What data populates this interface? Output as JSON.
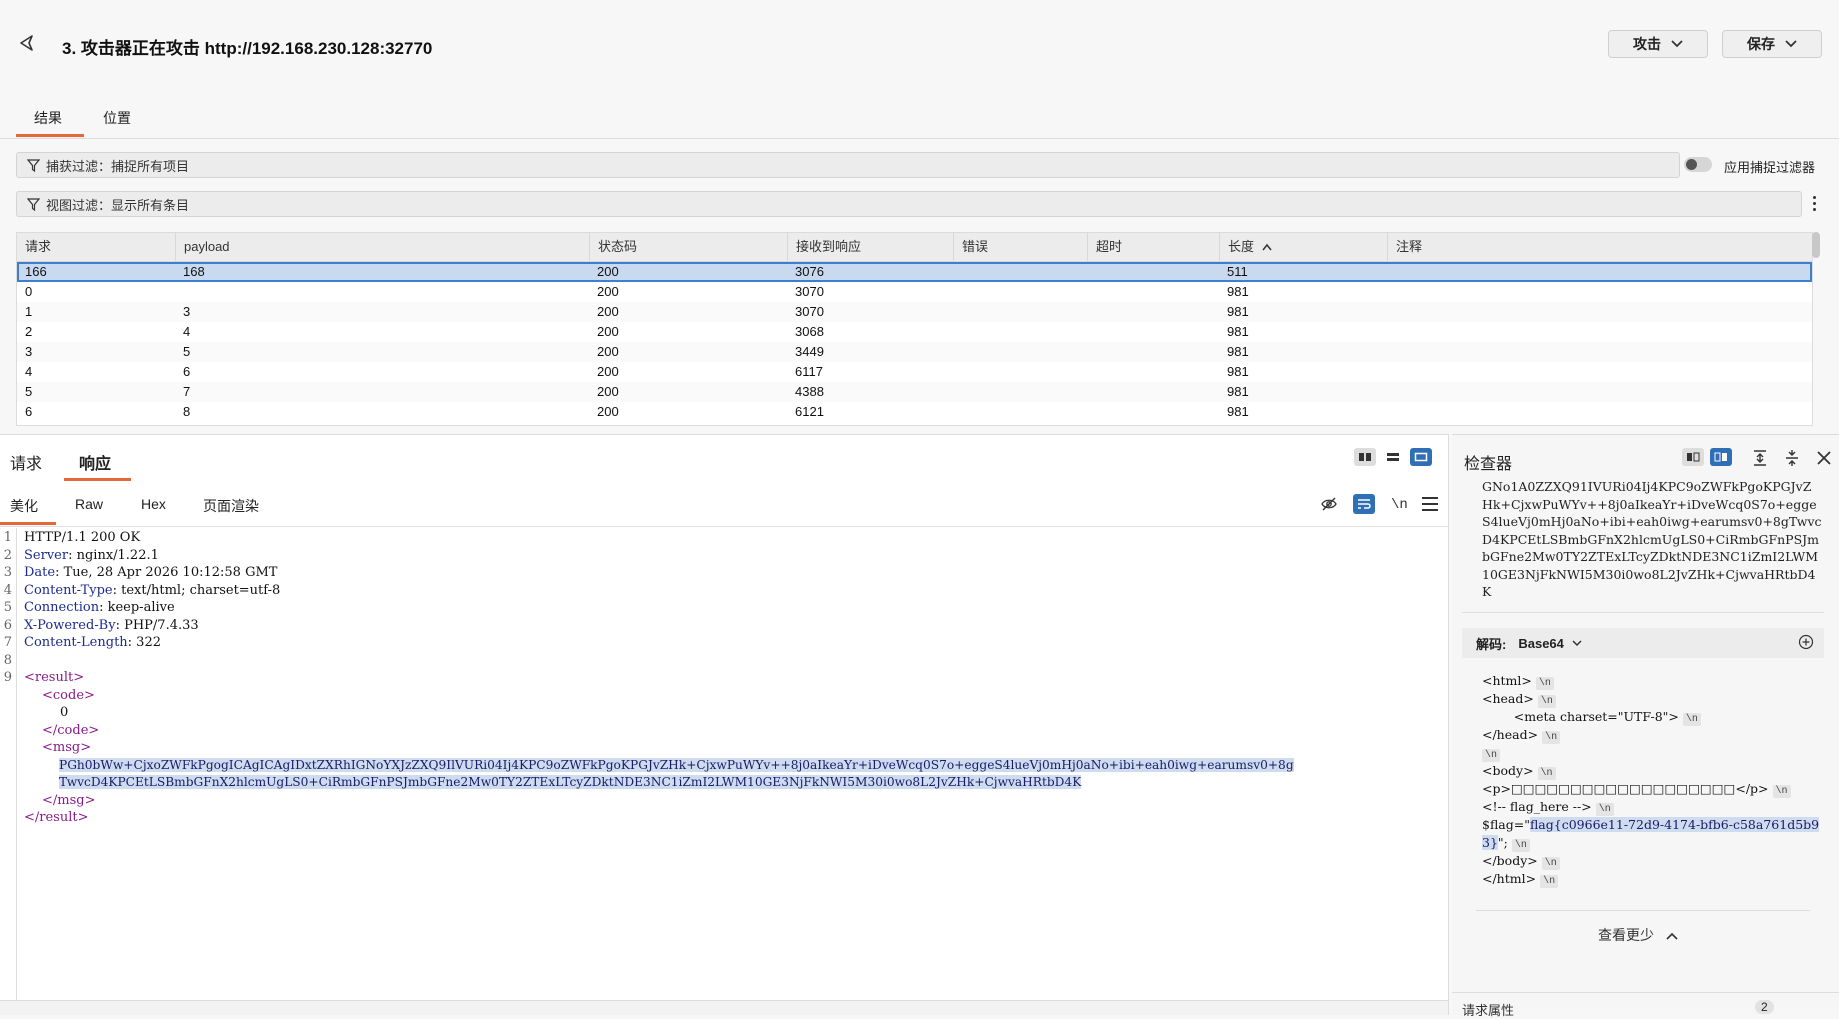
{
  "header": {
    "title": "3. 攻击器正在攻击 http://192.168.230.128:32770",
    "attack_label": "攻击",
    "save_label": "保存"
  },
  "top_tabs": [
    "结果",
    "位置"
  ],
  "filters": {
    "capture": "捕获过滤：捕捉所有项目",
    "view": "视图过滤：显示所有条目",
    "apply_capture_label": "应用捕捉过滤器"
  },
  "table": {
    "columns": [
      "请求",
      "payload",
      "状态码",
      "接收到响应",
      "错误",
      "超时",
      "长度",
      "注释"
    ],
    "rows": [
      [
        "166",
        "168",
        "200",
        "3076",
        "",
        "",
        "511",
        ""
      ],
      [
        "0",
        "",
        "200",
        "3070",
        "",
        "",
        "981",
        ""
      ],
      [
        "1",
        "3",
        "200",
        "3070",
        "",
        "",
        "981",
        ""
      ],
      [
        "2",
        "4",
        "200",
        "3068",
        "",
        "",
        "981",
        ""
      ],
      [
        "3",
        "5",
        "200",
        "3449",
        "",
        "",
        "981",
        ""
      ],
      [
        "4",
        "6",
        "200",
        "6117",
        "",
        "",
        "981",
        ""
      ],
      [
        "5",
        "7",
        "200",
        "4388",
        "",
        "",
        "981",
        ""
      ],
      [
        "6",
        "8",
        "200",
        "6121",
        "",
        "",
        "981",
        ""
      ]
    ]
  },
  "pane": {
    "tabs": [
      "请求",
      "响应"
    ],
    "subtabs": [
      "美化",
      "Raw",
      "Hex",
      "页面渲染"
    ],
    "newline_label": "\\n"
  },
  "response": {
    "lines": [
      {
        "n": "1",
        "key": "",
        "val": "HTTP/1.1 200 OK"
      },
      {
        "n": "2",
        "key": "Server",
        "val": ": nginx/1.22.1"
      },
      {
        "n": "3",
        "key": "Date",
        "val": ": Tue, 28 Apr 2026 10:12:58 GMT"
      },
      {
        "n": "4",
        "key": "Content-Type",
        "val": ": text/html; charset=utf-8"
      },
      {
        "n": "5",
        "key": "Connection",
        "val": ": keep-alive"
      },
      {
        "n": "6",
        "key": "X-Powered-By",
        "val": ": PHP/7.4.33"
      },
      {
        "n": "7",
        "key": "Content-Length",
        "val": ": 322"
      },
      {
        "n": "8",
        "key": "",
        "val": ""
      },
      {
        "n": "9",
        "key": "",
        "val": ""
      }
    ],
    "xml": {
      "result_open": "<result>",
      "code_open": "<code>",
      "code_value": "0",
      "code_close": "</code>",
      "msg_open": "<msg>",
      "msg_line1": "PGh0bWw+CjxoZWFkPgogICAgICAgIDxtZXRhIGNoYXJzZXQ9IlVURi04Ij4KPC9oZWFkPgoKPGJvZHk+CjxwPuWYv++8j0aIkeaYr+iDveWcq0S7o+eggeS4lueVj0mHj0aNo+ibi+eah0iwg+earumsv0+8g",
      "msg_line2": "TwvcD4KPCEtLSBmbGFnX2hlcmUgLS0+CiRmbGFnPSJmbGFne2Mw0TY2ZTExLTcyZDktNDE3NC1iZmI2LWM10GE3NjFkNWI5M30i0wo8L2JvZHk+CjwvaHRtbD4K",
      "msg_close": "</msg>",
      "result_close": "</result>"
    }
  },
  "inspector": {
    "title": "检查器",
    "top_text": "GNo1A0ZZXQ91IVURi04Ij4KPC9oZWFkPgoKPGJvZHk+CjxwPuWYv++8j0aIkeaYr+iDveWcq0S7o+eggeS4lueVj0mHj0aNo+ibi+eah0iwg+earumsv0+8gTwvcD4KPCEtLSBmbGFnX2hlcmUgLS0+CiRmbGFnPSJmbGFne2Mw0TY2ZTExLTcyZDktNDE3NC1iZmI2LWM10GE3NjFkNWI5M30i0wo8L2JvZHk+CjwvaHRtbD4K",
    "decode_label": "解码:",
    "decode_type": "Base64",
    "decoded_lines": [
      "<html>",
      "<head>",
      "        <meta charset=\"UTF-8\">",
      "</head>",
      "",
      "<body>",
      "<p>□□□□□□□□□□□□□□□□□□□</p>",
      "<!-- flag_here -->",
      "$flag=\"",
      "flag{c0966e11-72d9-4174-bfb6-c58a761d5b93}",
      "\";",
      "</body>",
      "</html>"
    ],
    "see_less": "查看更少",
    "req_attr_label": "请求属性",
    "req_attr_count": "2"
  }
}
